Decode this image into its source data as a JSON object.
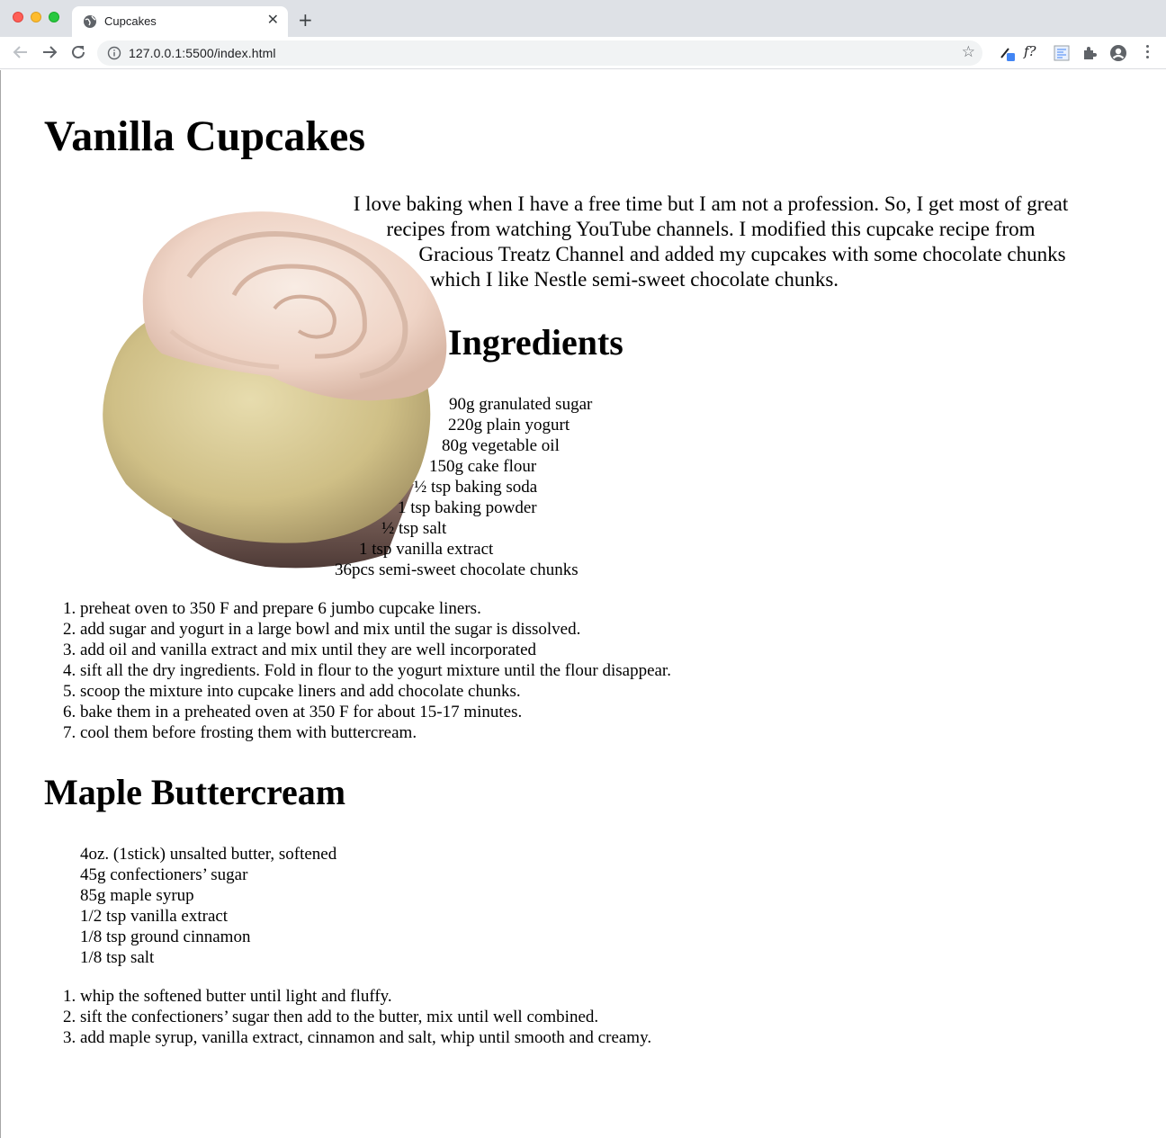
{
  "browser": {
    "tab_title": "Cupcakes",
    "tab_close": "✕",
    "new_tab": "+",
    "url": "127.0.0.1:5500/index.html",
    "ext_f": "f?",
    "icons": [
      "close-icon",
      "plus-icon",
      "back-arrow-icon",
      "forward-arrow-icon",
      "reload-icon",
      "info-icon",
      "star-icon",
      "eyedropper-icon",
      "puzzle-icon",
      "profile-icon",
      "more-vert-icon"
    ]
  },
  "page": {
    "title": "Vanilla Cupcakes",
    "intro_lines": [
      "I love baking when I have a free time but I am not a profession. So, I get most of great",
      "recipes from watching YouTube channels. I modified this cupcake recipe from",
      "Gracious Treatz Channel and added my cupcakes with some chocolate chunks",
      "which I like Nestle semi-sweet chocolate chunks."
    ],
    "ingredients_heading": "Ingredients",
    "ingredients": [
      "90g granulated sugar",
      "220g plain yogurt",
      "80g vegetable oil",
      "150g cake flour",
      "½ tsp baking soda",
      "1 tsp baking powder",
      "½ tsp salt",
      "1 tsp vanilla extract",
      "36pcs semi-sweet chocolate chunks"
    ],
    "steps": [
      "preheat oven to 350 F and prepare 6 jumbo cupcake liners.",
      "add sugar and yogurt in a large bowl and mix until the sugar is dissolved.",
      "add oil and vanilla extract and mix until they are well incorporated",
      "sift all the dry ingredients. Fold in flour to the yogurt mixture until the flour disappear.",
      "scoop the mixture into cupcake liners and add chocolate chunks.",
      "bake them in a preheated oven at 350 F for about 15-17 minutes.",
      "cool them before frosting them with buttercream."
    ],
    "buttercream_heading": "Maple Buttercream",
    "buttercream_ingredients": [
      "4oz. (1stick) unsalted butter, softened",
      "45g confectioners’ sugar",
      "85g maple syrup",
      "1/2 tsp vanilla extract",
      "1/8 tsp ground cinnamon",
      "1/8 tsp salt"
    ],
    "buttercream_steps": [
      "whip the softened butter until light and fluffy.",
      "sift the confectioners’ sugar then add to the butter, mix until well combined.",
      "add maple syrup, vanilla extract, cinnamon and salt, whip until smooth and creamy."
    ]
  }
}
